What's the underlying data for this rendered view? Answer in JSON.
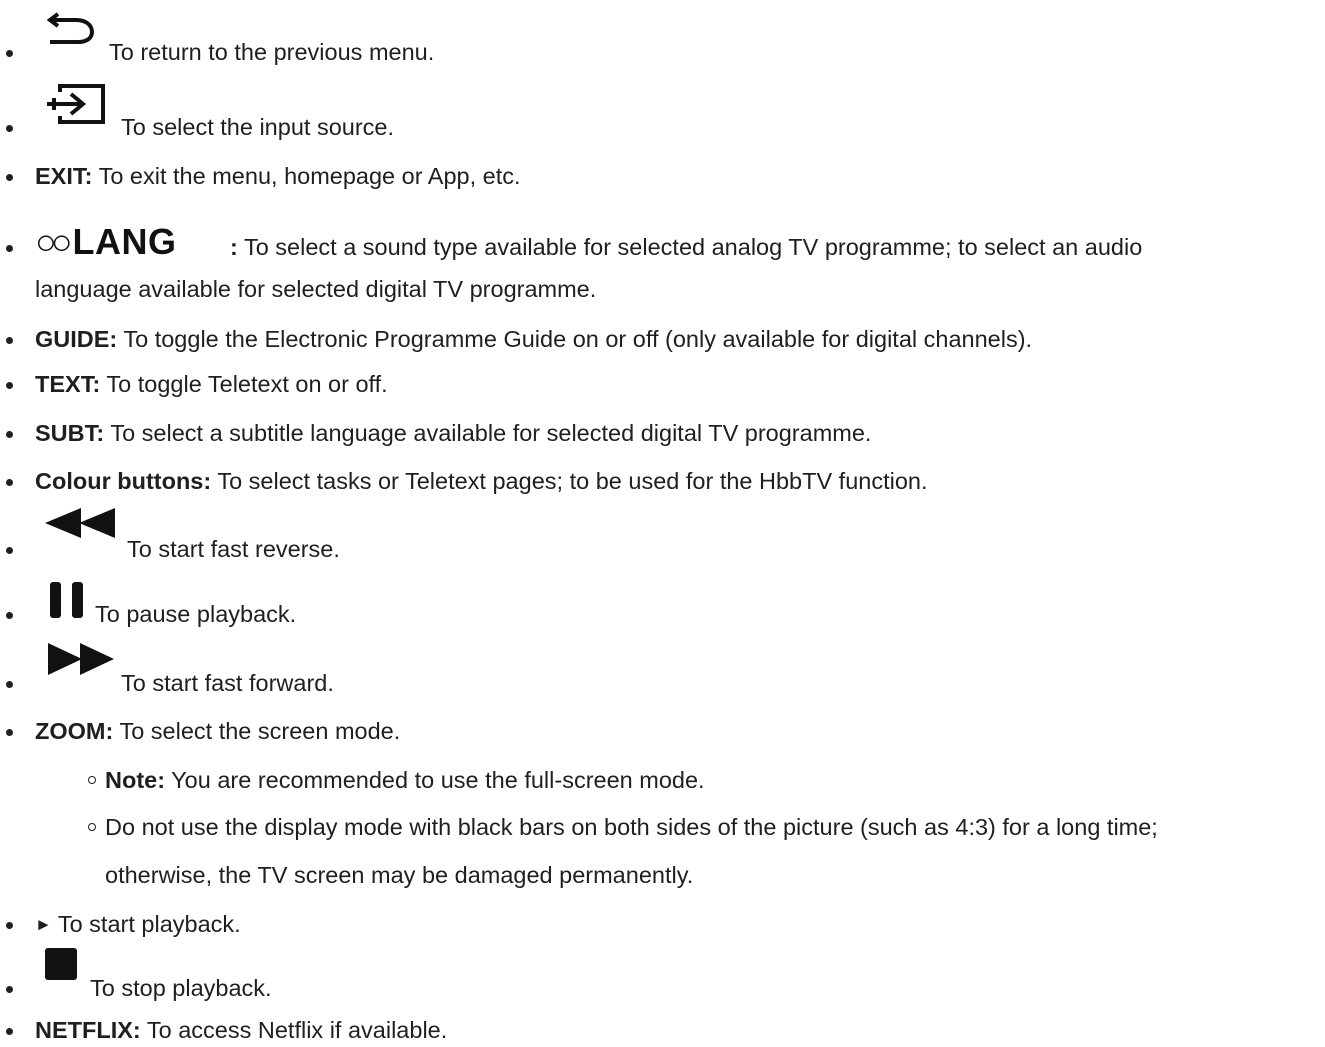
{
  "items": {
    "return": {
      "icon": "return-arrow-icon",
      "text": "To return to the previous menu."
    },
    "input": {
      "icon": "input-source-icon",
      "text": "To select the input source."
    },
    "exit": {
      "label": "EXIT:",
      "text": "To exit the menu, homepage or App, etc."
    },
    "lang": {
      "icon_text": "LANG",
      "colon": ":",
      "text1": "To select a sound type available for selected analog  TV programme; to select an audio",
      "text2": "language available for selected digital TV programme."
    },
    "guide": {
      "label": "GUIDE:",
      "text": "To toggle the Electronic Programme Guide on or off (only available for digital channels)."
    },
    "teletext": {
      "label": "TEXT:",
      "text": "To toggle Teletext on or off."
    },
    "subt": {
      "label": "SUBT:",
      "text": "To select a subtitle language available for selected digital TV programme."
    },
    "colour": {
      "label": "Colour buttons:",
      "text": "To select tasks or Teletext pages; to be used for the HbbTV function."
    },
    "reverse": {
      "icon": "fast-reverse-icon",
      "text": "To start fast reverse."
    },
    "pause": {
      "icon": "pause-icon",
      "text": "To pause playback."
    },
    "forward": {
      "icon": "fast-forward-icon",
      "text": "To start fast forward."
    },
    "zoom": {
      "label": "ZOOM:",
      "text": "To select the screen mode.",
      "note_label": "Note:",
      "note_text": "You are recommended to use the full-screen mode.",
      "warn_text1": "Do not use the display mode with black bars on both sides of the picture (such as 4:3) for a long time;",
      "warn_text2": "otherwise, the TV screen may be damaged permanently."
    },
    "play": {
      "glyph": "►",
      "text": "To start playback."
    },
    "stop": {
      "icon": "stop-icon",
      "text": "To stop playback."
    },
    "netflix": {
      "label": "NETFLIX:",
      "text": "To access Netflix if available."
    }
  },
  "colors": {
    "text": "#1f1f1f",
    "icon": "#111111",
    "background": "#ffffff"
  }
}
